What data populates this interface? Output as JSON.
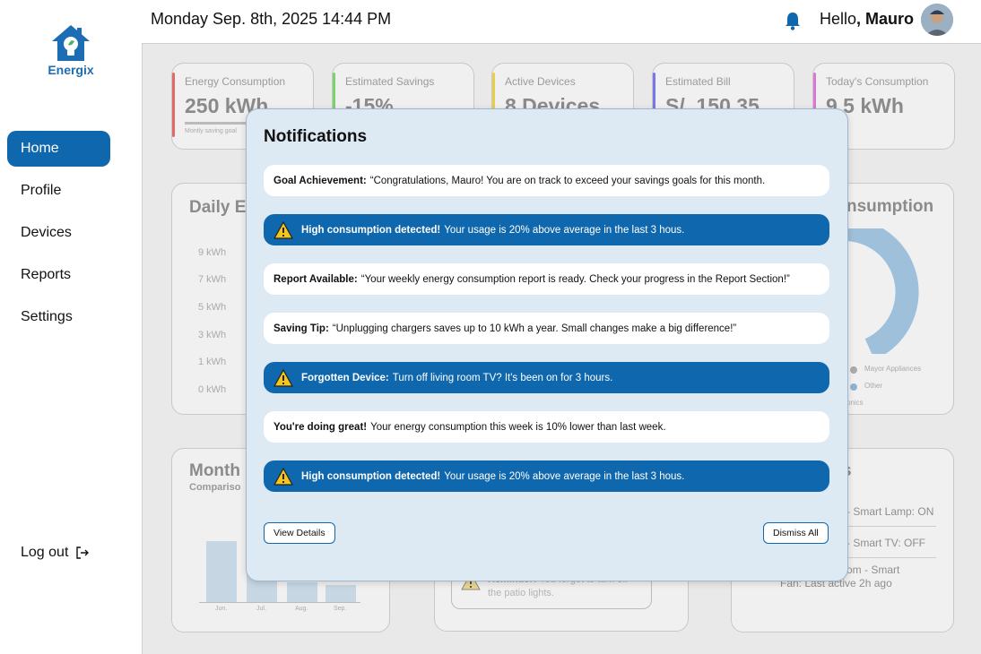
{
  "app": {
    "name": "Energix"
  },
  "header": {
    "datetime": "Monday  Sep. 8th, 2025  14:44 PM",
    "greeting": "Hello",
    "user": "Mauro"
  },
  "sidebar": {
    "items": [
      {
        "label": "Home",
        "active": true
      },
      {
        "label": "Profile"
      },
      {
        "label": "Devices"
      },
      {
        "label": "Reports"
      },
      {
        "label": "Settings"
      }
    ],
    "logout": "Log out"
  },
  "dashboard": {
    "stats": [
      {
        "label": "Energy Consumption",
        "value": "250 kWh",
        "note": "Montly saving goal",
        "color": "#e46a6a"
      },
      {
        "label": "Estimated Savings",
        "value": "-15%",
        "color": "#7bd36b"
      },
      {
        "label": "Active Devices",
        "value": "8 Devices",
        "color": "#e8cf4a"
      },
      {
        "label": "Estimated Bill",
        "value": "S/. 150.35",
        "color": "#7a78e8"
      },
      {
        "label": "Today's Consumption",
        "value": "9.5 kWh",
        "color": "#d67ad6"
      }
    ],
    "daily_title": "Daily E",
    "y_ticks": [
      "9 kWh",
      "7 kWh",
      "5 kWh",
      "3 kWh",
      "1 kWh",
      "0 kWh"
    ],
    "consumption_title": "nsumption",
    "legend": [
      "Mayor Appliances",
      "Other"
    ],
    "legend_extra": "onics",
    "monthly_title": "Month",
    "monthly_sub": "Compariso",
    "months": [
      "Jun.",
      "Jul.",
      "Aug.",
      "Sep."
    ],
    "month_values": [
      100,
      58,
      32,
      28
    ],
    "devices_title": "s",
    "devices": [
      "- Smart Lamp: ON",
      "- Smart TV: OFF",
      "om - Smart",
      "Fan: Last active 2h ago"
    ],
    "reminder": {
      "title": "Reminder:",
      "text": "You forgot to turn off",
      "text2": "the patio lights."
    }
  },
  "modal": {
    "title": "Notifications",
    "notifications": [
      {
        "type": "plain",
        "title": "Goal Achievement:",
        "text": "“Congratulations, Mauro! You are on track to exceed your savings goals for this month."
      },
      {
        "type": "alert",
        "title": "High consumption detected!",
        "text": "Your usage is 20% above average in the last 3 hous."
      },
      {
        "type": "plain",
        "title": "Report Available:",
        "text": "“Your weekly energy consumption report is ready. Check your progress in the Report Section!”"
      },
      {
        "type": "plain",
        "title": "Saving Tip:",
        "text": "“Unplugging chargers saves up to 10 kWh a year. Small changes make a big difference!”"
      },
      {
        "type": "alert",
        "title": "Forgotten Device:",
        "text": "Turn off living room TV? It's been on for 3 hours."
      },
      {
        "type": "plain",
        "title": "You're doing great!",
        "text": "Your energy consumption this week is 10% lower than last week."
      },
      {
        "type": "alert",
        "title": "High consumption detected!",
        "text": "Your usage is 20% above average in the last 3 hous."
      }
    ],
    "view_details": "View Details",
    "dismiss_all": "Dismiss All"
  }
}
